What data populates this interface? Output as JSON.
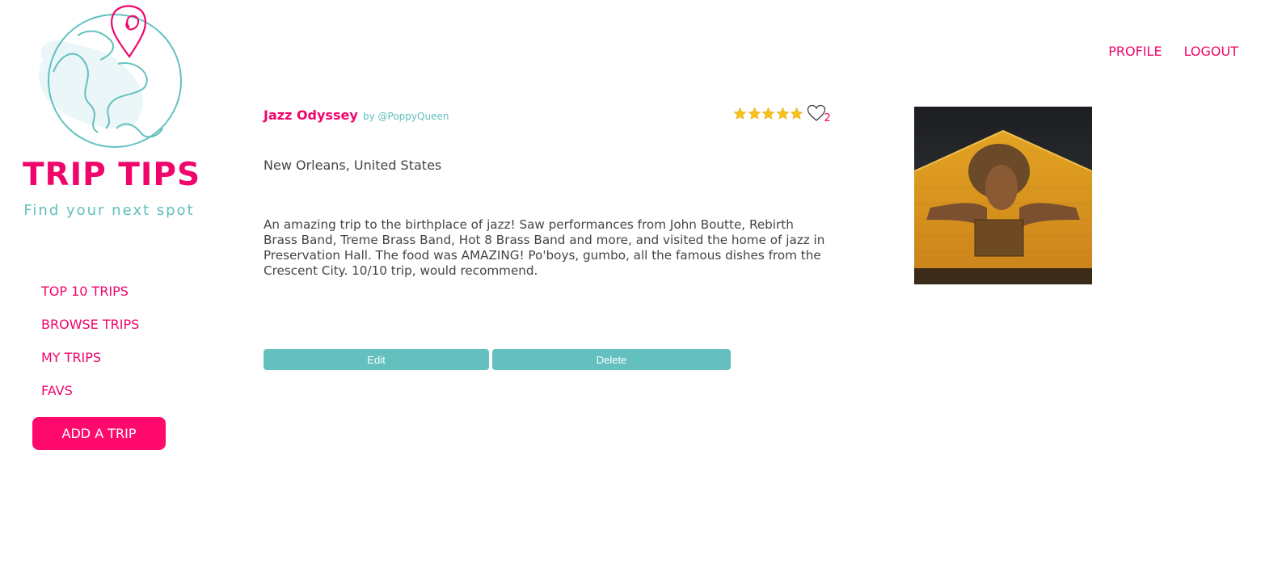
{
  "brand": {
    "title": "TRIP TIPS",
    "tagline": "Find your next spot",
    "colors": {
      "accent": "#f0056a",
      "teal": "#5fbfbc"
    }
  },
  "top_nav": {
    "profile": "PROFILE",
    "logout": "LOGOUT"
  },
  "sidebar": {
    "items": [
      {
        "label": "TOP 10 TRIPS"
      },
      {
        "label": "BROWSE TRIPS"
      },
      {
        "label": "MY TRIPS"
      },
      {
        "label": "FAVS"
      }
    ],
    "add_trip": "ADD A TRIP"
  },
  "trip": {
    "title": "Jazz Odyssey",
    "author": "by @PoppyQueen",
    "rating_stars": 5,
    "fav_count": "2",
    "location": "New Orleans, United States",
    "description": "An amazing trip to the birthplace of jazz! Saw performances from John Boutte, Rebirth Brass Band, Treme Brass Band, Hot 8 Brass Band and more, and visited the home of jazz in Preservation Hall. The food was AMAZING! Po'boys, gumbo, all the famous dishes from the Crescent City. 10/10 trip, would recommend.",
    "edit_label": "Edit",
    "delete_label": "Delete",
    "photo_icon": "mural-photo"
  }
}
